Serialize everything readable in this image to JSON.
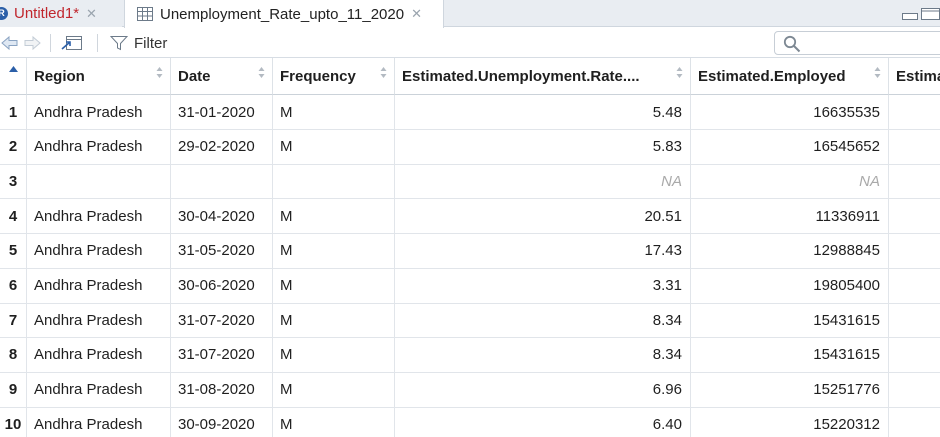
{
  "tabs": [
    {
      "label": "Untitled1*",
      "close": "✕"
    },
    {
      "label": "Unemployment_Rate_upto_11_2020",
      "close": "✕"
    }
  ],
  "toolbar": {
    "filter_label": "Filter",
    "search_placeholder": ""
  },
  "table": {
    "columns": [
      "Region",
      "Date",
      "Frequency",
      "Estimated.Unemployment.Rate....",
      "Estimated.Employed",
      "Estima"
    ],
    "rows": [
      {
        "n": "1",
        "region": "Andhra Pradesh",
        "date": "31-01-2020",
        "freq": "M",
        "rate": "5.48",
        "employed": "16635535",
        "extra": ""
      },
      {
        "n": "2",
        "region": "Andhra Pradesh",
        "date": "29-02-2020",
        "freq": "M",
        "rate": "5.83",
        "employed": "16545652",
        "extra": ""
      },
      {
        "n": "3",
        "region": "",
        "date": "",
        "freq": "",
        "rate": "NA",
        "employed": "NA",
        "extra": ""
      },
      {
        "n": "4",
        "region": "Andhra Pradesh",
        "date": "30-04-2020",
        "freq": "M",
        "rate": "20.51",
        "employed": "11336911",
        "extra": ""
      },
      {
        "n": "5",
        "region": "Andhra Pradesh",
        "date": "31-05-2020",
        "freq": "M",
        "rate": "17.43",
        "employed": "12988845",
        "extra": ""
      },
      {
        "n": "6",
        "region": "Andhra Pradesh",
        "date": "30-06-2020",
        "freq": "M",
        "rate": "3.31",
        "employed": "19805400",
        "extra": ""
      },
      {
        "n": "7",
        "region": "Andhra Pradesh",
        "date": "31-07-2020",
        "freq": "M",
        "rate": "8.34",
        "employed": "15431615",
        "extra": ""
      },
      {
        "n": "8",
        "region": "Andhra Pradesh",
        "date": "31-07-2020",
        "freq": "M",
        "rate": "8.34",
        "employed": "15431615",
        "extra": ""
      },
      {
        "n": "9",
        "region": "Andhra Pradesh",
        "date": "31-08-2020",
        "freq": "M",
        "rate": "6.96",
        "employed": "15251776",
        "extra": ""
      },
      {
        "n": "10",
        "region": "Andhra Pradesh",
        "date": "30-09-2020",
        "freq": "M",
        "rate": "6.40",
        "employed": "15220312",
        "extra": ""
      }
    ]
  },
  "colors": {
    "tab_modified": "#c0262d",
    "accent": "#2b5fa8",
    "na_text": "#a9a9a9"
  }
}
